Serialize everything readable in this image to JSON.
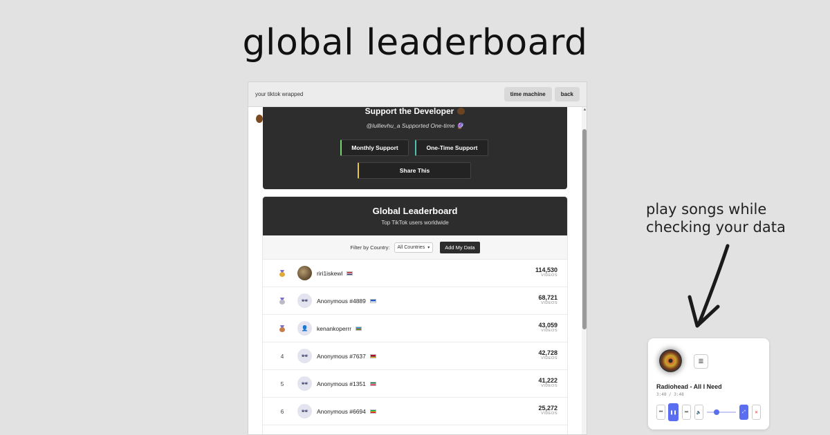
{
  "hero": {
    "title": "global leaderboard"
  },
  "app": {
    "name": "your tiktok wrapped",
    "buttons": {
      "time_machine": "time machine",
      "back": "back"
    }
  },
  "support": {
    "title": "Support the Developer",
    "note": "@lullievhu_a Supported One-time 🔮",
    "monthly_label": "Monthly Support",
    "onetime_label": "One-Time Support",
    "share_label": "Share This"
  },
  "leaderboard": {
    "title": "Global Leaderboard",
    "subtitle": "Top TikTok users worldwide",
    "filter_label": "Filter by Country:",
    "filter_value": "All Countries",
    "add_label": "Add My Data",
    "count_label": "VIDEOS",
    "rows": [
      {
        "rank": "",
        "medal": "gold",
        "name": "riri1iskewl",
        "count": "114,530",
        "avatar": "photo",
        "flag_colors": [
          "#b22234",
          "#ffffff",
          "#3c3b6e"
        ]
      },
      {
        "rank": "",
        "medal": "silver",
        "name": "Anonymous #4889",
        "count": "68,721",
        "avatar": "sunglasses-icon",
        "flag_colors": [
          "#2a5bbd",
          "#2a5bbd",
          "#ffffff"
        ]
      },
      {
        "rank": "",
        "medal": "bronze",
        "name": "kenankoperrr",
        "count": "43,059",
        "avatar": "person-icon",
        "flag_colors": [
          "#00b5e2",
          "#ef3340",
          "#509e2f"
        ]
      },
      {
        "rank": "4",
        "medal": "",
        "name": "Anonymous #7637",
        "count": "42,728",
        "avatar": "sunglasses-icon",
        "flag_colors": [
          "#d90012",
          "#0033a0",
          "#f2a800"
        ]
      },
      {
        "rank": "5",
        "medal": "",
        "name": "Anonymous #1351",
        "count": "41,222",
        "avatar": "sunglasses-icon",
        "flag_colors": [
          "#006233",
          "#ffffff",
          "#d21034"
        ]
      },
      {
        "rank": "6",
        "medal": "",
        "name": "Anonymous #6694",
        "count": "25,272",
        "avatar": "sunglasses-icon",
        "flag_colors": [
          "#009e60",
          "#fcd116",
          "#ce1126"
        ]
      }
    ]
  },
  "side_note": {
    "line1": "play songs while",
    "line2": "checking your data"
  },
  "player": {
    "track": "Radiohead - All I Need",
    "time": "3:48 / 3:48",
    "accent": "#5b6ef0",
    "icons": [
      "album-art",
      "playlist-icon",
      "previous-icon",
      "pause-icon",
      "next-icon",
      "volume-icon",
      "expand-icon",
      "close-icon"
    ]
  }
}
